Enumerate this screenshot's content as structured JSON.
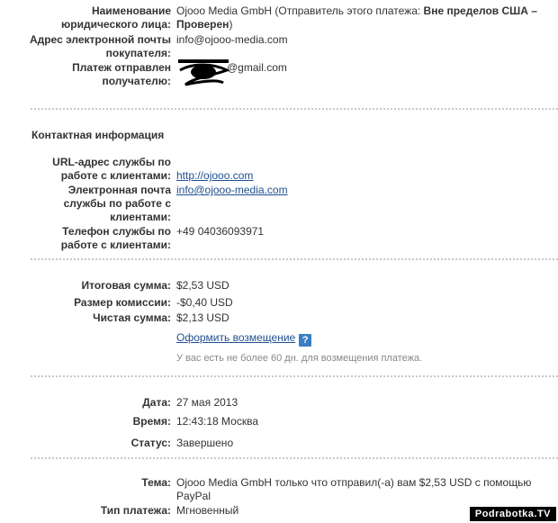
{
  "payer": {
    "name_label": "Наименование юридического лица:",
    "name_value": "Ojooo Media GmbH (Отправитель этого платежа: ",
    "name_status": "Вне пределов США – Проверен",
    "name_close": ")",
    "email_label": "Адрес электронной почты покупателя:",
    "email_value": "info@ojooo-media.com",
    "sent_to_label": "Платеж отправлен получателю:",
    "sent_to_value": "@gmail.com"
  },
  "contact": {
    "title": "Контактная информация",
    "url_label": "URL-адрес службы по работе с клиентами:",
    "url_value": "http://ojooo.com",
    "email_label": "Электронная почта службы по работе с клиентами:",
    "email_value": "info@ojooo-media.com",
    "phone_label": "Телефон службы по работе с клиентами:",
    "phone_value": "+49 04036093971"
  },
  "amounts": {
    "total_label": "Итоговая сумма:",
    "total_value": "$2,53 USD",
    "fee_label": "Размер комиссии:",
    "fee_value": "-$0,40 USD",
    "net_label": "Чистая сумма:",
    "net_value": "$2,13 USD",
    "refund_link": "Оформить возмещение",
    "help_icon": "?",
    "refund_note": "У вас есть не более 60 дн. для возмещения платежа."
  },
  "details": {
    "date_label": "Дата:",
    "date_value": "27 мая 2013",
    "time_label": "Время:",
    "time_value": "12:43:18 Москва",
    "status_label": "Статус:",
    "status_value": "Завершено"
  },
  "message": {
    "subject_label": "Тема:",
    "subject_value": "Ojooo Media GmbH только что отправил(-а) вам $2,53 USD с помощью PayPal",
    "type_label": "Тип платежа:",
    "type_value": "Мгновенный"
  },
  "watermark": "Podrabotka.TV"
}
